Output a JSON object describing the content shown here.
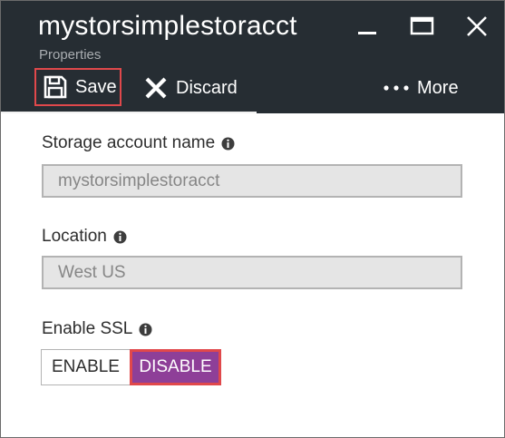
{
  "header": {
    "title": "mystorsimplestoracct",
    "subtitle": "Properties",
    "window_controls": {
      "minimize_icon": "minimize-icon",
      "maximize_icon": "maximize-icon",
      "close_icon": "close-icon"
    }
  },
  "toolbar": {
    "save_label": "Save",
    "save_icon": "save-disk-icon",
    "discard_label": "Discard",
    "discard_icon": "x-icon",
    "more_label": "More",
    "more_icon": "ellipsis-icon"
  },
  "form": {
    "storage_account": {
      "label": "Storage account name",
      "value": "mystorsimplestoracct"
    },
    "location": {
      "label": "Location",
      "value": "West US"
    },
    "ssl": {
      "label": "Enable SSL",
      "options": [
        "ENABLE",
        "DISABLE"
      ],
      "selected": "DISABLE"
    }
  },
  "colors": {
    "header_bg": "#262d33",
    "accent_selected": "#8e3f98",
    "highlight_border": "#e0484b"
  }
}
